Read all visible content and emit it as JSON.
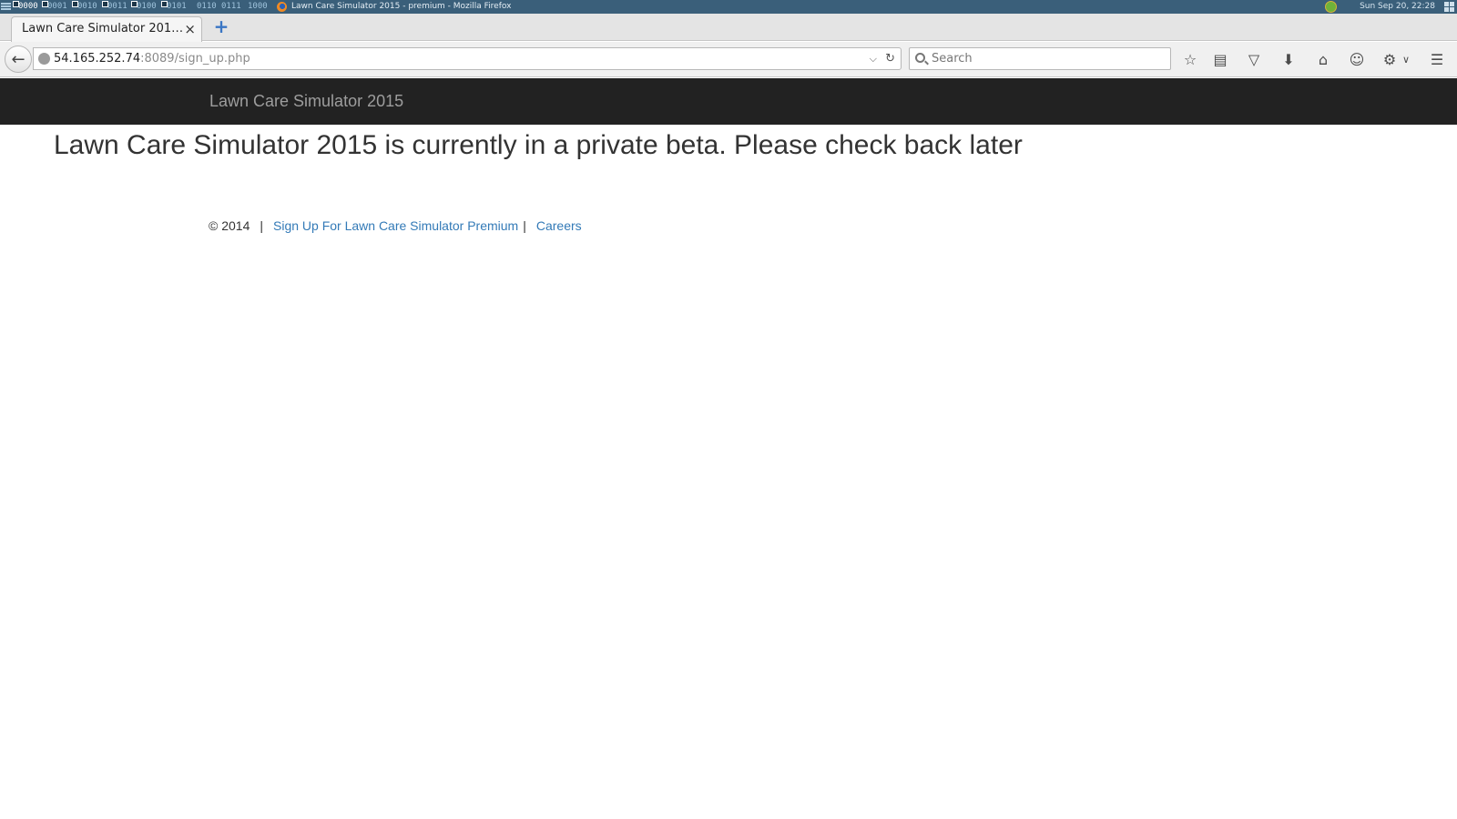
{
  "system_panel": {
    "workspaces": [
      "0000",
      "0001",
      "0010",
      "0011",
      "0100",
      "0101",
      "0110",
      "0111",
      "1000"
    ],
    "window_title": "Lawn Care Simulator 2015 - premium - Mozilla Firefox",
    "clock": "Sun Sep 20, 22:28"
  },
  "browser": {
    "tab_title": "Lawn Care Simulator 201…",
    "tab_close": "×",
    "new_tab": "+",
    "url_host": "54.165.252.74",
    "url_rest": ":8089/sign_up.php",
    "search_placeholder": "Search"
  },
  "page": {
    "brand": "Lawn Care Simulator 2015",
    "message": "Lawn Care Simulator 2015 is currently in a private beta. Please check back later",
    "footer": {
      "copyright": "© 2014",
      "separator": "|",
      "signup_link": "Sign Up For Lawn Care Simulator Premium",
      "careers_link": "Careers"
    }
  },
  "colors": {
    "navbar_bg": "#222222",
    "brand_text": "#9d9d9d",
    "link": "#337ab7",
    "panel_bg": "#3a5f7a"
  },
  "icons": [
    "back-arrow-icon",
    "globe-icon",
    "dropdown-arrow-icon",
    "reload-icon",
    "search-icon",
    "bookmark-star-icon",
    "reading-list-icon",
    "pocket-icon",
    "download-icon",
    "home-icon",
    "chat-icon",
    "extension-icon",
    "hamburger-menu-icon"
  ]
}
